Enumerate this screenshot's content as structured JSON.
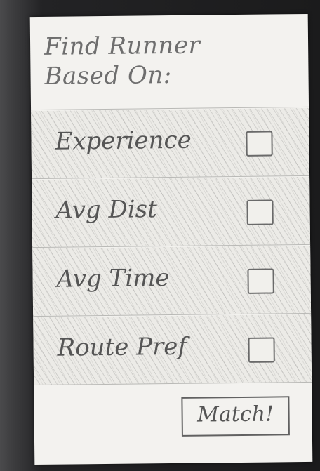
{
  "header": {
    "title_line1": "Find Runner",
    "title_line2": "Based On:"
  },
  "criteria": [
    {
      "label": "Experience",
      "checked": false
    },
    {
      "label": "Avg Dist",
      "checked": false
    },
    {
      "label": "Avg Time",
      "checked": false
    },
    {
      "label": "Route Pref",
      "checked": false
    }
  ],
  "actions": {
    "match_label": "Match!"
  }
}
